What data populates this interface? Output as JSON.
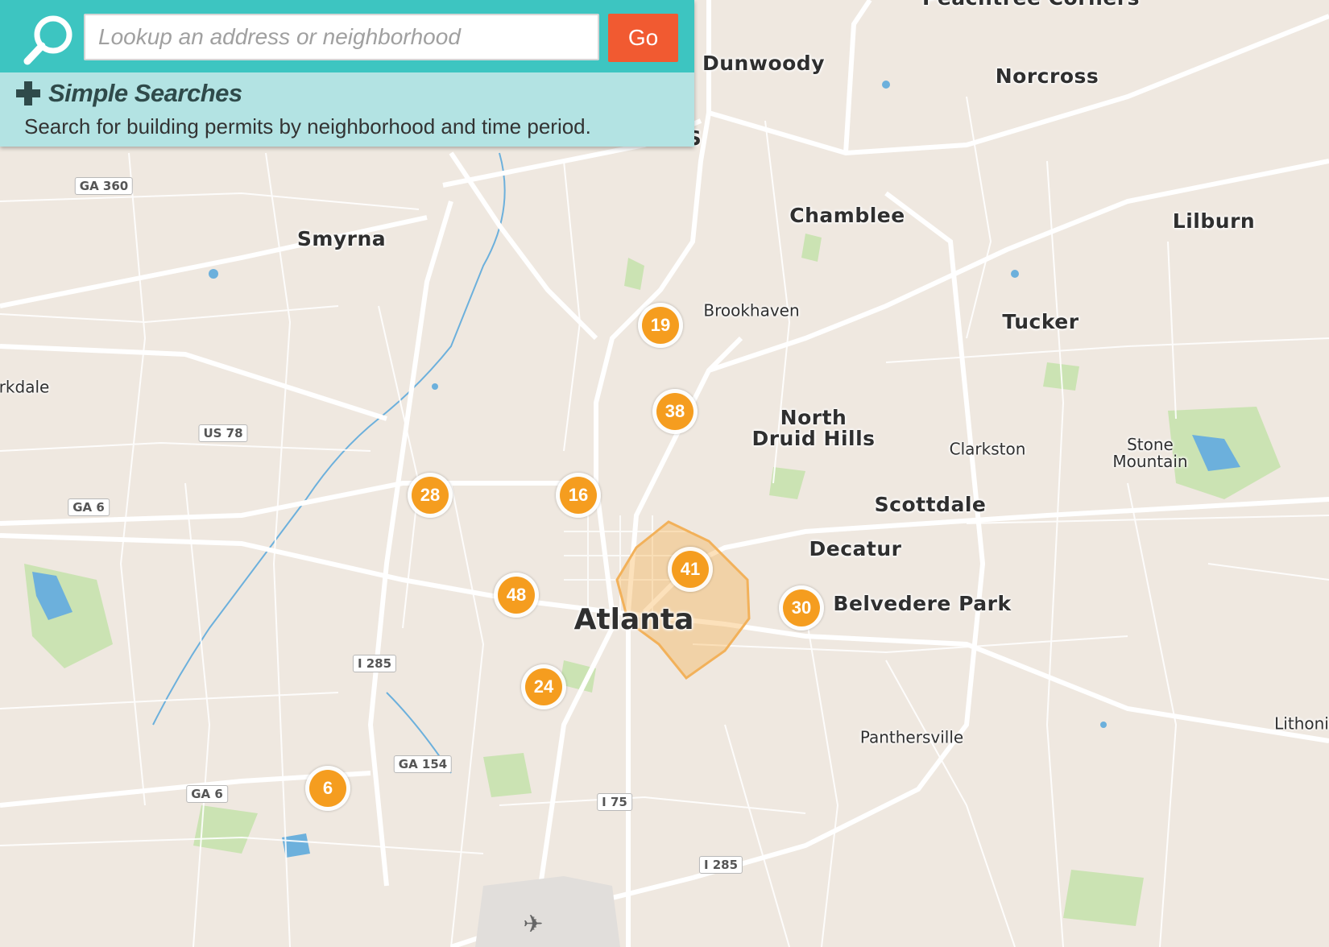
{
  "search": {
    "placeholder": "Lookup an address or neighborhood",
    "value": "",
    "go_label": "Go"
  },
  "simple_searches": {
    "title": "Simple Searches",
    "description": "Search for building permits by neighborhood and time period."
  },
  "map": {
    "places": [
      {
        "id": "peachtree-corners",
        "label": "Peachtree Corners"
      },
      {
        "id": "dunwoody",
        "label": "Dunwoody"
      },
      {
        "id": "norcross",
        "label": "Norcross"
      },
      {
        "id": "chamblee",
        "label": "Chamblee"
      },
      {
        "id": "lilburn",
        "label": "Lilburn"
      },
      {
        "id": "smyrna",
        "label": "Smyrna"
      },
      {
        "id": "brookhaven",
        "label": "Brookhaven"
      },
      {
        "id": "tucker",
        "label": "Tucker"
      },
      {
        "id": "parkdale",
        "label": "rkdale"
      },
      {
        "id": "north-druid-hills",
        "label": "North\nDruid Hills"
      },
      {
        "id": "clarkston",
        "label": "Clarkston"
      },
      {
        "id": "stone-mountain",
        "label": "Stone\nMountain"
      },
      {
        "id": "scottdale",
        "label": "Scottdale"
      },
      {
        "id": "decatur",
        "label": "Decatur"
      },
      {
        "id": "belvedere-park",
        "label": "Belvedere Park"
      },
      {
        "id": "atlanta",
        "label": "Atlanta"
      },
      {
        "id": "panthersville",
        "label": "Panthersville"
      },
      {
        "id": "lithonia",
        "label": "Lithoni"
      },
      {
        "id": "springs-fragment",
        "label": "S"
      }
    ],
    "shields": [
      {
        "id": "ga360",
        "label": "GA 360"
      },
      {
        "id": "us78",
        "label": "US 78"
      },
      {
        "id": "ga6-north",
        "label": "GA 6"
      },
      {
        "id": "i285-west",
        "label": "I 285"
      },
      {
        "id": "ga154",
        "label": "GA 154"
      },
      {
        "id": "ga6-south",
        "label": "GA 6"
      },
      {
        "id": "i75",
        "label": "I 75"
      },
      {
        "id": "i285-south",
        "label": "I 285"
      }
    ],
    "clusters": [
      {
        "id": "cluster-19",
        "count": "19"
      },
      {
        "id": "cluster-38",
        "count": "38"
      },
      {
        "id": "cluster-28",
        "count": "28"
      },
      {
        "id": "cluster-16",
        "count": "16"
      },
      {
        "id": "cluster-41",
        "count": "41"
      },
      {
        "id": "cluster-48",
        "count": "48"
      },
      {
        "id": "cluster-30",
        "count": "30"
      },
      {
        "id": "cluster-24",
        "count": "24"
      },
      {
        "id": "cluster-6",
        "count": "6"
      }
    ],
    "colors": {
      "land": "#efe8e0",
      "road": "#ffffff",
      "park": "#c9e3b0",
      "water": "#5aa6d8",
      "cluster": "#f59d1f",
      "highlight": "#f7b764"
    },
    "icons": [
      "search-icon",
      "plus-icon",
      "airport-icon"
    ]
  }
}
